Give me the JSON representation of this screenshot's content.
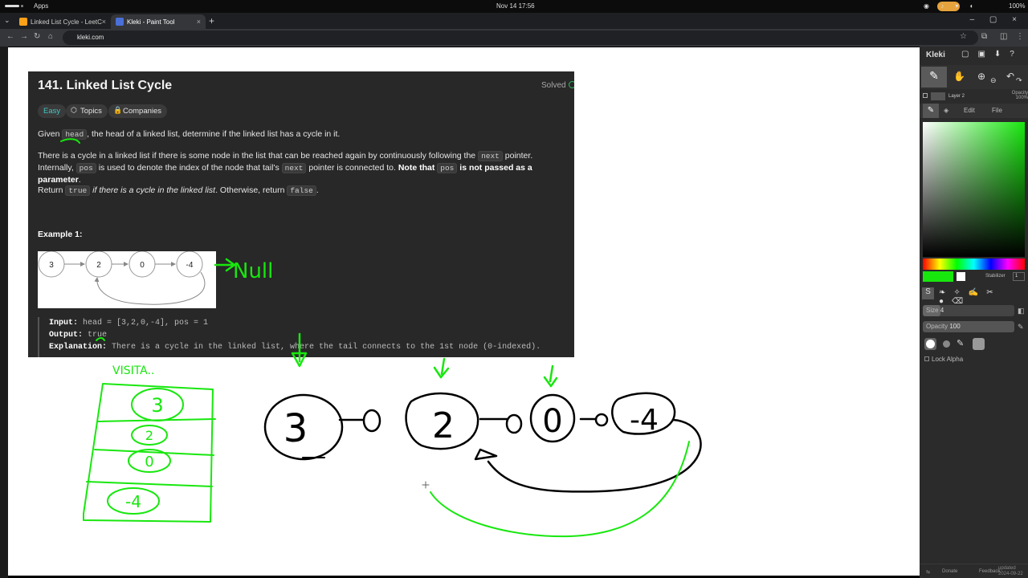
{
  "os": {
    "apps_label": "Apps",
    "clock": "Nov 14  17:56",
    "battery": "100%"
  },
  "browser": {
    "tabs": [
      {
        "title": "Linked List Cycle - LeetC",
        "active": false
      },
      {
        "title": "Kleki - Paint Tool",
        "active": true
      }
    ],
    "new_tab": "+",
    "url": "kleki.com"
  },
  "leetcode": {
    "title": "141. Linked List Cycle",
    "status": "Solved",
    "chips": {
      "difficulty": "Easy",
      "topics": "Topics",
      "companies": "Companies"
    },
    "p1": {
      "pre": "Given ",
      "code": "head",
      "post": ", the head of a linked list, determine if the linked list has a cycle in it."
    },
    "p2": {
      "a": "There is a cycle in a linked list if there is some node in the list that can be reached again by continuously following the ",
      "code1": "next",
      "b": " pointer. Internally, ",
      "code2": "pos",
      "c": " is used to denote the index of the node that tail's ",
      "code3": "next",
      "d": " pointer is connected to. ",
      "bold1": "Note that ",
      "code4": "pos",
      "bold2": " is not passed as a parameter",
      "e": "."
    },
    "p3": {
      "a": "Return ",
      "code1": "true",
      "italic": " if there is a cycle in the linked list",
      "b": ". Otherwise, return ",
      "code2": "false",
      "c": "."
    },
    "example_heading": "Example 1:",
    "example_nodes": [
      "3",
      "2",
      "0",
      "-4"
    ],
    "example": {
      "input_label": "Input:",
      "input_value": " head = [3,2,0,-4], pos = 1",
      "output_label": "Output:",
      "output_value": " true",
      "explanation_label": "Explanation:",
      "explanation_value": " There is a cycle in the linked list, where the tail connects to the 1st node (0-indexed)."
    }
  },
  "kleki": {
    "logo": "Kleki",
    "layer_name": "Layer 2",
    "layer_opacity": "Opacity 100%",
    "tabs": {
      "edit": "Edit",
      "file": "File"
    },
    "current_color": "#18e70e",
    "stabilizer_label": "Stabilizer",
    "stabilizer_value": "1",
    "size_label": "Size",
    "size_value": "4",
    "opacity_label": "Opacity",
    "opacity_value": "100",
    "lock_alpha": "Lock Alpha",
    "footer": {
      "donate": "Donate",
      "feedback": "Feedback",
      "updated": "updated 2024-09-22"
    }
  },
  "drawing": {
    "annotation_null": "Null",
    "visited_label": "VISITA..",
    "visited_stack": [
      "3",
      "2",
      "0",
      "-4"
    ],
    "nodes": [
      "3",
      "2",
      "0",
      "-4"
    ],
    "colors": {
      "ink": "#000000",
      "green": "#18e70e"
    }
  }
}
